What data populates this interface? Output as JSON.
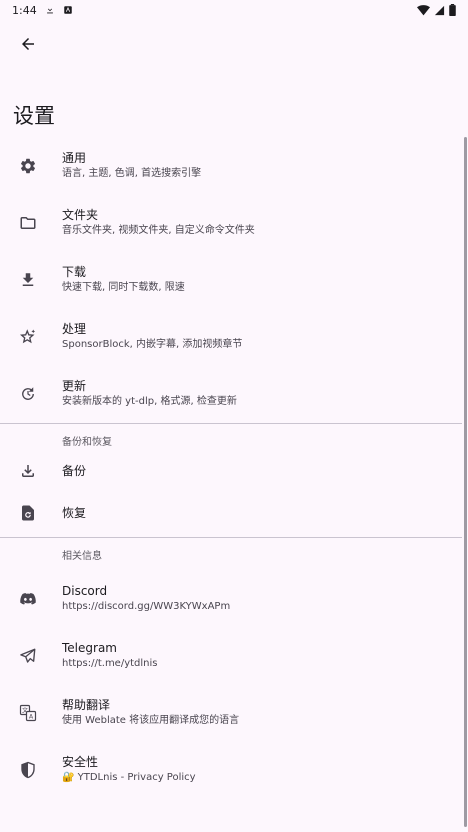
{
  "status": {
    "time": "1:44"
  },
  "page": {
    "title": "设置"
  },
  "items_main": [
    {
      "title": "通用",
      "subtitle": "语言, 主题, 色调, 首选搜索引擎",
      "icon": "gear-icon"
    },
    {
      "title": "文件夹",
      "subtitle": "音乐文件夹, 视频文件夹, 自定义命令文件夹",
      "icon": "folder-icon"
    },
    {
      "title": "下载",
      "subtitle": "快速下载, 同时下载数, 限速",
      "icon": "download-icon"
    },
    {
      "title": "处理",
      "subtitle": "SponsorBlock, 内嵌字幕, 添加视频章节",
      "icon": "star-sparkle-icon"
    },
    {
      "title": "更新",
      "subtitle": "安装新版本的 yt-dlp, 格式源, 检查更新",
      "icon": "update-icon"
    }
  ],
  "backup_section": {
    "header": "备份和恢复",
    "items": [
      {
        "title": "备份",
        "icon": "backup-download-icon"
      },
      {
        "title": "恢复",
        "icon": "restore-icon"
      }
    ]
  },
  "about_section": {
    "header": "相关信息",
    "items": [
      {
        "title": "Discord",
        "subtitle": "https://discord.gg/WW3KYWxAPm",
        "icon": "discord-icon"
      },
      {
        "title": "Telegram",
        "subtitle": "https://t.me/ytdlnis",
        "icon": "telegram-icon"
      },
      {
        "title": "帮助翻译",
        "subtitle": "使用 Weblate 将该应用翻译成您的语言",
        "icon": "translate-icon"
      },
      {
        "title": "安全性",
        "subtitle": "🔐 YTDLnis - Privacy Policy",
        "icon": "shield-icon"
      }
    ]
  },
  "colors": {
    "background": "#fdf7fd",
    "text": "#1c1b1f",
    "subtext": "#49454f",
    "divider": "#cac4d0"
  }
}
